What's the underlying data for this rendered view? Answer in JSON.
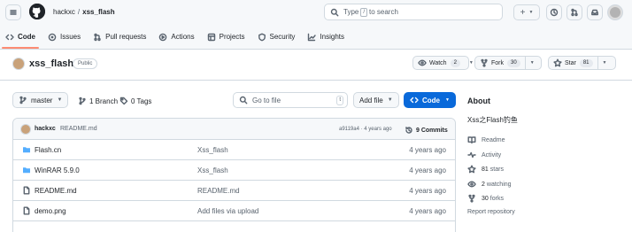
{
  "header": {
    "owner": "hackxc",
    "separator": "/",
    "repo": "xss_flash",
    "search_prefix": "Type",
    "search_key": "/",
    "search_suffix": "to search",
    "new_label": "+"
  },
  "tabs": [
    {
      "label": "Code",
      "icon": "code-icon"
    },
    {
      "label": "Issues",
      "icon": "issue-icon"
    },
    {
      "label": "Pull requests",
      "icon": "pull-request-icon"
    },
    {
      "label": "Actions",
      "icon": "actions-icon"
    },
    {
      "label": "Projects",
      "icon": "projects-icon"
    },
    {
      "label": "Security",
      "icon": "shield-icon"
    },
    {
      "label": "Insights",
      "icon": "graph-icon"
    }
  ],
  "repo": {
    "name": "xss_flash",
    "visibility": "Public",
    "watch_label": "Watch",
    "watch_count": "2",
    "fork_label": "Fork",
    "fork_count": "30",
    "star_label": "Star",
    "star_count": "81"
  },
  "toolbar": {
    "branch": "master",
    "branches": "1 Branch",
    "tags": "0 Tags",
    "goto_placeholder": "Go to file",
    "goto_key": "t",
    "add_file": "Add file",
    "code": "Code"
  },
  "commit": {
    "author": "hackxc",
    "message": "README.md",
    "sha": "a9119a4",
    "dot": "·",
    "age": "4 years ago",
    "commits": "9 Commits"
  },
  "files": [
    {
      "name": "Flash.cn",
      "type": "folder",
      "message": "Xss_flash",
      "date": "4 years ago"
    },
    {
      "name": "WinRAR 5.9.0",
      "type": "folder",
      "message": "Xss_flash",
      "date": "4 years ago"
    },
    {
      "name": "README.md",
      "type": "file",
      "message": "README.md",
      "date": "4 years ago"
    },
    {
      "name": "demo.png",
      "type": "file",
      "message": "Add files via upload",
      "date": "4 years ago"
    }
  ],
  "about": {
    "title": "About",
    "description": "Xss之Flash钓鱼",
    "readme": "Readme",
    "activity": "Activity",
    "stars_count": "81",
    "stars_label": "stars",
    "watching_count": "2",
    "watching_label": "watching",
    "forks_count": "30",
    "forks_label": "forks",
    "report": "Report repository"
  },
  "colors": {
    "accent": "#0969da",
    "tab_underline": "#fd8c73",
    "folder": "#54aeff"
  }
}
